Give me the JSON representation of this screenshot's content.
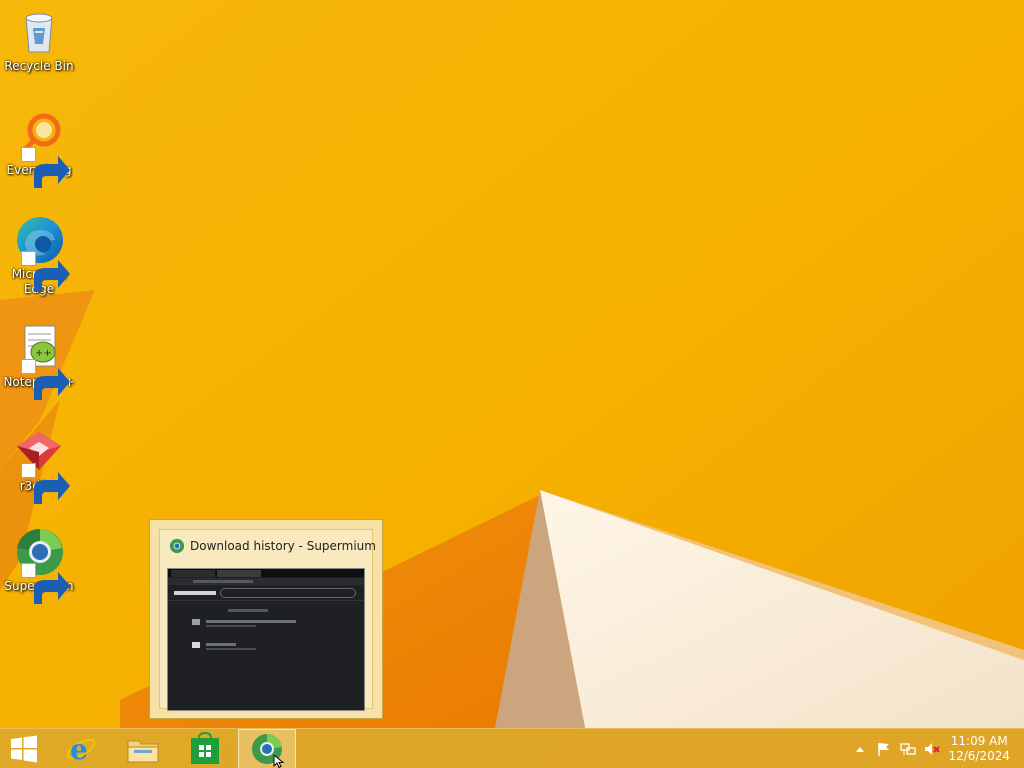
{
  "desktop": {
    "icons": [
      {
        "label": "Recycle Bin",
        "icon": "recycle-bin-icon",
        "shortcut": false
      },
      {
        "label": "Everything",
        "icon": "everything-icon",
        "shortcut": true
      },
      {
        "label": "Microsoft Edge",
        "icon": "edge-icon",
        "shortcut": true
      },
      {
        "label": "Notepad++",
        "icon": "notepadpp-icon",
        "shortcut": true
      },
      {
        "label": "r3dfox",
        "icon": "r3dfox-icon",
        "shortcut": true
      },
      {
        "label": "Supermium",
        "icon": "supermium-icon",
        "shortcut": true
      }
    ]
  },
  "thumbnail": {
    "title": "Download history - Supermium"
  },
  "taskbar": {
    "buttons": [
      {
        "name": "internet-explorer",
        "icon": "internet-explorer-icon"
      },
      {
        "name": "file-explorer",
        "icon": "folder-icon"
      },
      {
        "name": "store",
        "icon": "store-icon"
      },
      {
        "name": "supermium",
        "icon": "supermium-icon",
        "active": true
      }
    ],
    "tray": {
      "icons": [
        "chevron-up-icon",
        "flag-icon",
        "network-icon",
        "volume-muted-icon"
      ]
    },
    "clock": {
      "time": "11:09 AM",
      "date": "12/6/2024"
    }
  },
  "colors": {
    "wallpaper": "#f2a900",
    "taskbar": "#daa630"
  }
}
